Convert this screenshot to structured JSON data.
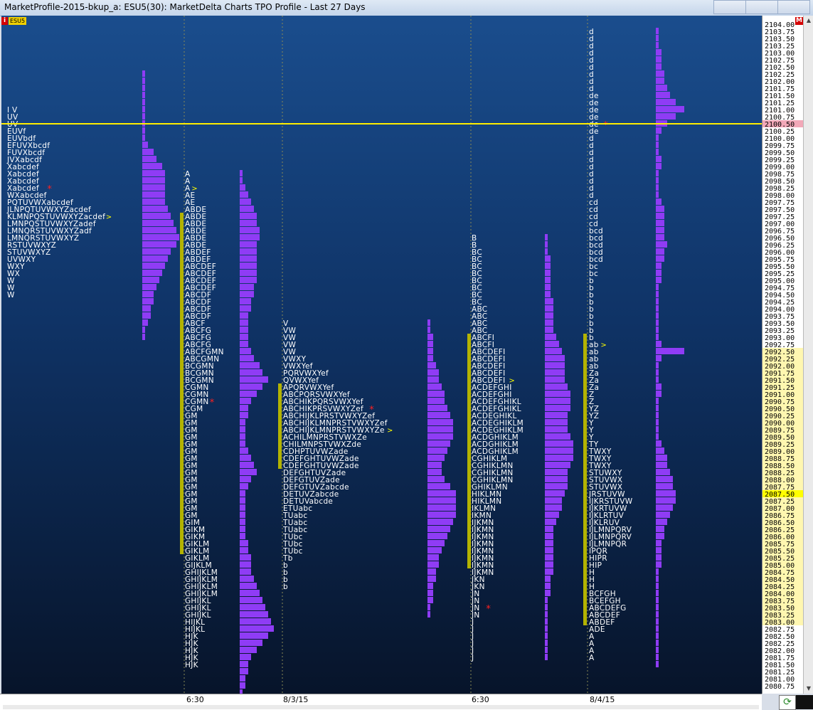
{
  "window": {
    "title": "MarketProfile-2015-bkup_a: ESU5(30): MarketDelta Charts TPO Profile - Last 27 Days"
  },
  "symbol": {
    "info_icon": "i",
    "name": "ESU5",
    "menu_label": "M"
  },
  "axis": {
    "price_start": 2104.0,
    "price_step": 0.25,
    "count": 94,
    "current_price": "2100.50",
    "highlight_price": "2087.50",
    "value_area_from": "2092.50",
    "value_area_to": "2083.00"
  },
  "time_axis": [
    "6:30",
    "8/3/15",
    "6:30",
    "8/4/15"
  ],
  "colors": {
    "histogram": "#8f3cf5",
    "va_bar": "#b3b300",
    "price_line": "#ffee00",
    "letters": "#ffffff",
    "poc_marker": "#ff2020",
    "bg_top": "#1a4d8d",
    "bg_bottom": "#07142a"
  },
  "profiles": [
    {
      "id": "p1",
      "hist_top": "2102.25",
      "hist_bottom": "2093.00",
      "hist_counts": [
        1,
        1,
        1,
        1,
        1,
        1,
        1,
        1,
        1,
        1,
        2,
        4,
        5,
        7,
        8,
        8,
        8,
        8,
        8,
        9,
        10,
        11,
        12,
        13,
        12,
        10,
        9,
        8,
        7,
        6,
        5,
        4,
        4,
        3,
        3,
        2,
        1,
        1
      ],
      "tpo": [
        "I V",
        "UV",
        "UV",
        "EUVf",
        "EUVbdf",
        "EFUVXbcdf",
        "FUVXbcdf",
        "JVXabcdf",
        "Xabcdef",
        "Xabcdef",
        "Xabcdef",
        "Xabcdef",
        "WXabcdef",
        "PQTUVWXabcdef",
        "JLNPQTUVWXYZacdef",
        "KLMNPQSTUVWXYZacdef",
        "LMNPQSTUVWXYZadef",
        "LMNQRSTUVWXYZadf",
        "LMNQRSTUVWXYZ",
        "RSTUVWXYZ",
        "STUVWXYZ",
        "UVWXY",
        "WXY",
        "WX",
        "W",
        "W",
        "W"
      ],
      "tpo_top": "2101.00",
      "poc_price": "2098.25",
      "opening_price": "2097.25"
    },
    {
      "id": "p2",
      "tpo": [
        "A",
        "A",
        "A",
        "AE",
        "AE",
        "ABDE",
        "ABDE",
        "ABDE",
        "ABDE",
        "ABDE",
        "ABDE",
        "ABDEF",
        "ABDEF",
        "ABCDEF",
        "ABCDEF",
        "ABCDEF",
        "ABCDEF",
        "ABCDF",
        "ABCDF",
        "ABCDF",
        "ABCDF",
        "ABCF",
        "ABCFG",
        "ABCFG",
        "ABCFG",
        "ABCFGMN",
        "ABCGMN",
        "BCGMN",
        "BCGMN",
        "BCGMN",
        "CGMN",
        "CGMN",
        "CGMN",
        "CGM",
        "GM",
        "GM",
        "GM",
        "GM",
        "GM",
        "GM",
        "GM",
        "GM",
        "GM",
        "GM",
        "GM",
        "GM",
        "GM",
        "GM",
        "GM",
        "GIM",
        "GIKM",
        "GIKM",
        "GIKLM",
        "GIKLM",
        "GIKLM",
        "GIJKLM",
        "GHIJKLM",
        "GHIJKLM",
        "GHIJKLM",
        "GHIJKLM",
        "GHIJKL",
        "GHIJKL",
        "GHIJKL",
        "HIJKL",
        "HIJKL",
        "HJK",
        "HJK",
        "HJK",
        "HJK",
        "HJK"
      ],
      "tpo_top": "2098.75",
      "poc_price": "2090.75",
      "opening_price": "2098.25",
      "hist_top": "2098.75",
      "hist_counts": [
        1,
        1,
        2,
        3,
        4,
        5,
        6,
        6,
        7,
        7,
        6,
        6,
        6,
        6,
        6,
        6,
        5,
        5,
        4,
        4,
        3,
        3,
        3,
        3,
        3,
        4,
        5,
        7,
        8,
        10,
        8,
        6,
        4,
        3,
        3,
        2,
        2,
        2,
        2,
        3,
        4,
        5,
        6,
        4,
        3,
        2,
        2,
        2,
        2,
        2,
        2,
        2,
        3,
        3,
        4,
        4,
        4,
        5,
        6,
        7,
        8,
        9,
        10,
        11,
        12,
        10,
        8,
        6,
        4,
        3,
        3,
        2,
        2,
        1
      ]
    },
    {
      "id": "p3",
      "tpo": [
        "V",
        "VW",
        "VW",
        "VW",
        "VW",
        "VWXY",
        "VWXYef",
        "PQRVWXYef",
        "QVWXYef",
        "APQRVWXYef",
        "ABCPQRSVWXYef",
        "ABCHIKPQRSVWXYef",
        "ABCHIKPRSVWXYZef",
        "ABCHIJKLPRSTVWXYZef",
        "ABCHIJKLMNPRSTVWXYZef",
        "ABCHIJKLMNPRSTVWXYZe",
        "ACHILMNPRSTVWXZe",
        "CHILMNPSTVWXZde",
        "CDHPTUVWZade",
        "CDEFGHTUVWZade",
        "CDEFGHTUVWZade",
        "DEFGHTUVZade",
        "DEFGTUVZade",
        "DEFGTUVZabcde",
        "DETUVZabcde",
        "DETUVabcde",
        "ETUabc",
        "TUabc",
        "TUabc",
        "TUabc",
        "TUbc",
        "TUbc",
        "TUbc",
        "Tb",
        "b",
        "b",
        "b",
        "b"
      ],
      "tpo_top": "2093.50",
      "poc_price": "2090.50",
      "opening_price": "2089.75",
      "hist_top": "2093.50",
      "hist_counts": [
        1,
        1,
        2,
        2,
        2,
        2,
        3,
        4,
        4,
        5,
        6,
        6,
        7,
        8,
        9,
        9,
        9,
        8,
        7,
        6,
        5,
        5,
        6,
        8,
        10,
        10,
        10,
        10,
        9,
        8,
        7,
        6,
        5,
        4,
        4,
        3,
        3,
        2,
        2,
        2,
        1,
        1
      ]
    },
    {
      "id": "p4",
      "tpo": [
        "B",
        "B",
        "BC",
        "BC",
        "BC",
        "BC",
        "BC",
        "BC",
        "BC",
        "BC",
        "ABC",
        "ABC",
        "ABC",
        "ABC",
        "ABCFI",
        "ABCFI",
        "ABCDEFI",
        "ABCDEFI",
        "ABCDEFI",
        "ABCDEFI",
        "ABCDEFI",
        "ACDEFGHI",
        "ACDEFGHI",
        "ACDEFGHIKL",
        "ACDEFGHIKL",
        "ACDEGHIKL",
        "ACDEGHIKLM",
        "ACDEGHIKLM",
        "ACDGHIKLM",
        "ACDGHIKLM",
        "ACDGHIKLM",
        "CGHIKLM",
        "CGHIKLMN",
        "CGHIKLMN",
        "CGHIKLMN",
        "GHIKLMN",
        "HIKLMN",
        "HIKLMN",
        "IKLMN",
        "IKMN",
        "IJKMN",
        "IJKMN",
        "IJKMN",
        "IJKMN",
        "IJKMN",
        "IJKMN",
        "IJKMN",
        "IJKMN",
        "JKN",
        "JKN",
        "JN",
        "JN",
        "JN",
        "JN",
        "J",
        "J",
        "J",
        "J",
        "J",
        "J"
      ],
      "tpo_top": "2096.50",
      "poc_price": "2083.50",
      "opening_price": "2091.50",
      "hist_top": "2096.50",
      "hist_counts": [
        1,
        1,
        1,
        2,
        2,
        2,
        2,
        2,
        2,
        3,
        3,
        3,
        3,
        3,
        4,
        5,
        6,
        7,
        7,
        7,
        7,
        8,
        9,
        9,
        9,
        8,
        8,
        8,
        9,
        10,
        10,
        10,
        9,
        8,
        8,
        8,
        7,
        6,
        6,
        5,
        4,
        3,
        3,
        3,
        3,
        3,
        3,
        3,
        2,
        2,
        2,
        1,
        1,
        1,
        1,
        1,
        1,
        1,
        1,
        1
      ]
    },
    {
      "id": "p5",
      "tpo": [
        "d",
        "d",
        "d",
        "d",
        "d",
        "d",
        "d",
        "d",
        "d",
        "de",
        "de",
        "de",
        "de",
        "de",
        "de",
        "d",
        "d",
        "d",
        "d",
        "d",
        "d",
        "d",
        "d",
        "d",
        "cd",
        "cd",
        "cd",
        "cd",
        "bcd",
        "bcd",
        "bcd",
        "bcd",
        "bcd",
        "bc",
        "bc",
        "b",
        "b",
        "b",
        "b",
        "b",
        "b",
        "b",
        "b",
        "b",
        "ab",
        "ab",
        "ab",
        "ab",
        "Za",
        "Za",
        "Za",
        "Z",
        "Z",
        "YZ",
        "YZ",
        "Y",
        "Y",
        "Y",
        "TY",
        "TWXY",
        "TWXY",
        "TWXY",
        "STUWXY",
        "STUVWX",
        "STUVWX",
        "JRSTUVW",
        "IJKRSTUVW",
        "IJKRTUVW",
        "IJKLRTUV",
        "IJKLRUV",
        "IJLMNPQRV",
        "IJLMNPQRV",
        "IJLMNPQR",
        "IPQR",
        "HIPR",
        "HIP",
        "H",
        "H",
        "H",
        "BCFGH",
        "BCEFGH",
        "ABCDEFG",
        "ABCDEF",
        "ABDEF",
        "ADE",
        "A",
        "A",
        "A",
        "A"
      ],
      "tpo_top": "2103.75",
      "poc_price": "2100.50",
      "opening_price": "2092.75",
      "hist_top": "2103.75",
      "hist_counts": [
        1,
        1,
        1,
        2,
        2,
        2,
        3,
        3,
        4,
        5,
        7,
        10,
        7,
        4,
        2,
        1,
        1,
        1,
        2,
        2,
        1,
        1,
        1,
        1,
        2,
        3,
        3,
        3,
        3,
        3,
        4,
        3,
        3,
        2,
        2,
        2,
        1,
        1,
        1,
        1,
        1,
        1,
        1,
        1,
        2,
        10,
        2,
        1,
        1,
        1,
        2,
        2,
        1,
        1,
        1,
        1,
        1,
        1,
        2,
        3,
        4,
        4,
        5,
        6,
        6,
        7,
        7,
        6,
        5,
        4,
        3,
        3,
        2,
        2,
        2,
        2,
        1,
        1,
        1,
        1,
        1,
        1,
        1,
        1,
        1,
        1,
        1,
        1,
        1,
        1
      ]
    }
  ]
}
